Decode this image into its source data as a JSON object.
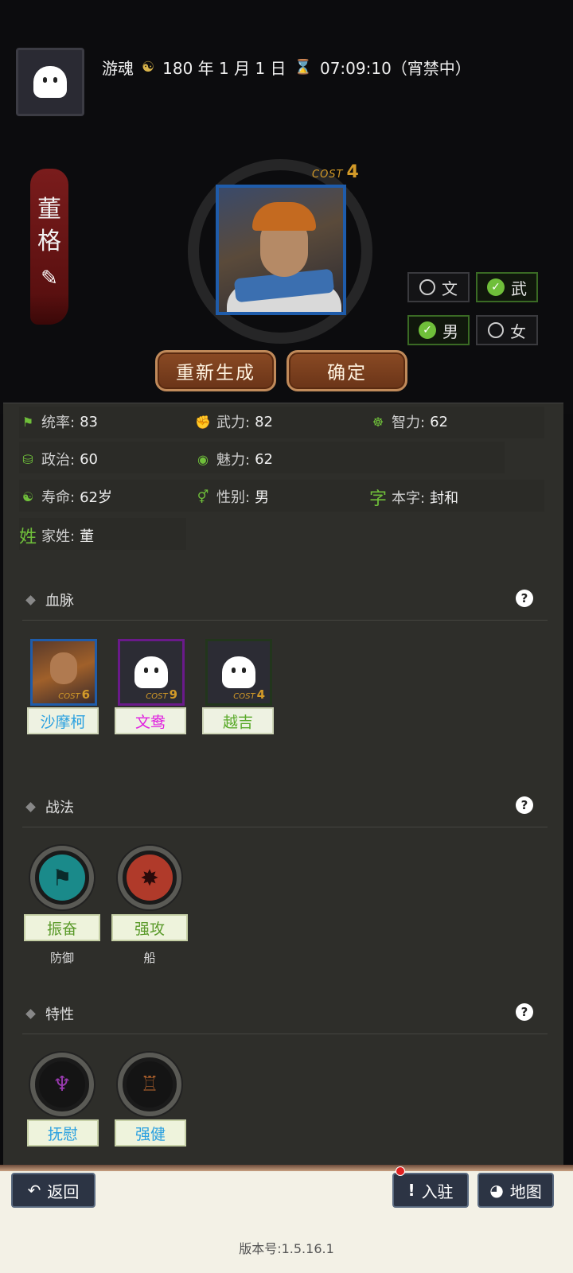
{
  "header": {
    "player_name": "游魂",
    "date": "180 年 1 月 1 日",
    "time": "07:09:10（宵禁中）"
  },
  "hero": {
    "name_chars": [
      "董",
      "格"
    ],
    "cost_label": "COST",
    "cost_value": "4",
    "options": {
      "wen": "文",
      "wu": "武",
      "male": "男",
      "female": "女",
      "wen_selected": false,
      "wu_selected": true,
      "male_selected": true,
      "female_selected": false
    },
    "buttons": {
      "regenerate": "重新生成",
      "confirm": "确定"
    }
  },
  "stats": {
    "leadership_label": "统率:",
    "leadership": "83",
    "force_label": "武力:",
    "force": "82",
    "intelligence_label": "智力:",
    "intelligence": "62",
    "politics_label": "政治:",
    "politics": "60",
    "charm_label": "魅力:",
    "charm": "62",
    "lifespan_label": "寿命:",
    "lifespan": "62岁",
    "gender_label": "性别:",
    "gender": "男",
    "courtesy_icon": "字",
    "courtesy_label": "本字:",
    "courtesy": "封和",
    "surname_icon": "姓",
    "surname_label": "家姓:",
    "surname": "董"
  },
  "sections": {
    "bloodline": "血脉",
    "tactics": "战法",
    "traits": "特性",
    "help": "?"
  },
  "bloodline": [
    {
      "name": "沙摩柯",
      "cost_label": "COST",
      "cost": "6",
      "color": "#2aa0e0",
      "border": "#1f5caa"
    },
    {
      "name": "文鸯",
      "cost_label": "COST",
      "cost": "9",
      "color": "#e020e0",
      "border": "#7a2a9a"
    },
    {
      "name": "越吉",
      "cost_label": "COST",
      "cost": "4",
      "color": "#5aaa2a",
      "border": "#2a4a22"
    }
  ],
  "tactics": [
    {
      "name": "振奋",
      "sub": "防御",
      "icon": "rally-icon",
      "glyph": "⚑",
      "bg": "#1a8a8a"
    },
    {
      "name": "强攻",
      "sub": "船",
      "icon": "assault-icon",
      "glyph": "✸",
      "bg": "#b03a2a"
    }
  ],
  "traits": [
    {
      "name": "抚慰",
      "icon": "toast-icon",
      "glyph": "🍷"
    },
    {
      "name": "强健",
      "icon": "strongman-icon",
      "glyph": "🏋"
    }
  ],
  "footer": {
    "back": "返回",
    "settle": "入驻",
    "map": "地图",
    "version": "版本号:1.5.16.1"
  }
}
